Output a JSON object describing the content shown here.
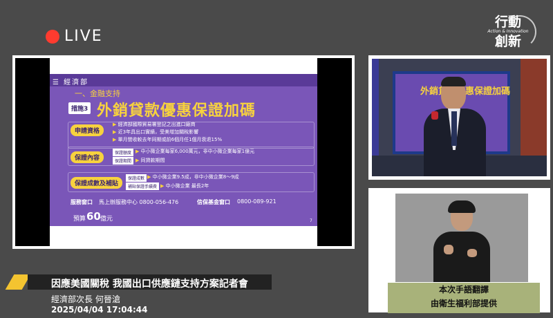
{
  "live": {
    "label": "LIVE"
  },
  "logo": {
    "line1": "行動",
    "tagline": "Action & Innovation",
    "line2": "創新"
  },
  "slide": {
    "ministry": "經濟部",
    "section": "一、金融支持",
    "measure_badge": "措施3",
    "measure_title": "外銷貸款優惠保證加碼",
    "qualification": {
      "label": "申請資格",
      "items": [
        "經濟部國際貿易署登記之出進口廠商",
        "近3年具出口實績，受美增加關稅影響",
        "單月營收較去年同期或前6個月任1個月衰退15%"
      ]
    },
    "content": {
      "label": "保證內容",
      "rows": [
        {
          "tag": "保證額度",
          "text": "中小微企業每家6,000萬元，非中小微企業每家1億元"
        },
        {
          "tag": "保證期間",
          "text": "同貸款期間"
        }
      ]
    },
    "subsidy": {
      "label": "保證成數及補貼",
      "rows": [
        {
          "tag": "保證成數",
          "text": "中小微企業9.5成，非中小微企業8～9成"
        },
        {
          "tag": "補貼保證手續費",
          "text": "中小微企業 最長2年"
        }
      ]
    },
    "service": {
      "label": "服務窗口",
      "text": "馬上辦服務中心 0800-056-476"
    },
    "fund": {
      "label": "信保基金窗口",
      "text": "0800-089-921"
    },
    "budget": {
      "label": "預算",
      "value": "60",
      "unit": "億元"
    },
    "page_no": "7"
  },
  "mini_slide": {
    "title": "外銷貸款優惠保證加碼"
  },
  "interpreter": {
    "caption_line1": "本次手語翻譯",
    "caption_line2": "由衛生福利部提供"
  },
  "lower_third": {
    "title": "因應美國關稅 我國出口供應鏈支持方案記者會",
    "speaker": "經濟部次長 何晉滄",
    "timestamp": "2025/04/04  17:04:44"
  },
  "colors": {
    "slide_purple": "#7a56b8",
    "accent_yellow": "#f7d23e",
    "live_red": "#ff3b2f",
    "caption_bg": "#a8b27a"
  }
}
